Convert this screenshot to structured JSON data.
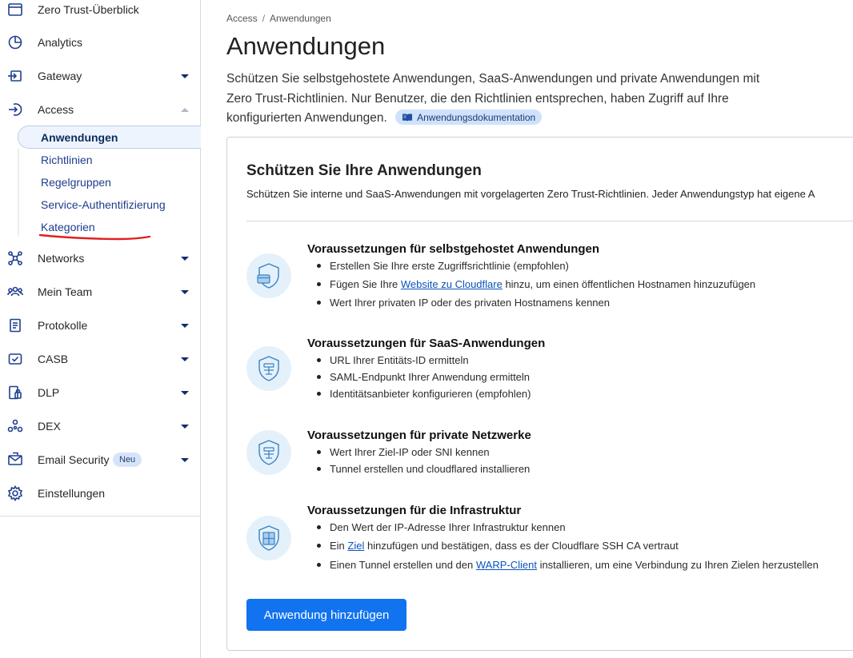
{
  "sidebar": {
    "items": [
      {
        "label": "Zero Trust-Überblick",
        "icon": "window-icon"
      },
      {
        "label": "Analytics",
        "icon": "pie-chart-icon"
      },
      {
        "label": "Gateway",
        "icon": "gateway-icon"
      },
      {
        "label": "Access",
        "icon": "login-icon"
      },
      {
        "label": "Networks",
        "icon": "network-icon"
      },
      {
        "label": "Mein Team",
        "icon": "team-icon"
      },
      {
        "label": "Protokolle",
        "icon": "document-icon"
      },
      {
        "label": "CASB",
        "icon": "casb-icon"
      },
      {
        "label": "DLP",
        "icon": "dlp-icon"
      },
      {
        "label": "DEX",
        "icon": "dex-icon"
      },
      {
        "label": "Email Security",
        "icon": "email-icon",
        "badge": "Neu"
      },
      {
        "label": "Einstellungen",
        "icon": "gear-icon"
      }
    ],
    "access_sub": [
      "Anwendungen",
      "Richtlinien",
      "Regelgruppen",
      "Service-Authentifizierung",
      "Kategorien"
    ]
  },
  "breadcrumb": {
    "root": "Access",
    "sep": "/",
    "current": "Anwendungen"
  },
  "page": {
    "title": "Anwendungen",
    "description": "Schützen Sie selbstgehostete Anwendungen, SaaS-Anwendungen und private Anwendungen mit Zero Trust-Richtlinien. Nur Benutzer, die den Richtlinien entsprechen, haben Zugriff auf Ihre konfigurierten Anwendungen.",
    "doc_link": "Anwendungsdokumentation"
  },
  "card": {
    "title": "Schützen Sie Ihre Anwendungen",
    "subtitle": "Schützen Sie interne und SaaS-Anwendungen mit vorgelagerten Zero Trust-Richtlinien. Jeder Anwendungstyp hat eigene A",
    "sections": [
      {
        "title": "Voraussetzungen für selbstgehostet Anwendungen",
        "b1": "Erstellen Sie Ihre erste Zugriffsrichtlinie (empfohlen)",
        "b2_pre": "Fügen Sie Ihre ",
        "b2_link": "Website zu Cloudflare",
        "b2_post": " hinzu, um einen öffentlichen Hostnamen hinzuzufügen",
        "b3": "Wert Ihrer privaten IP oder des privaten Hostnamens kennen"
      },
      {
        "title": "Voraussetzungen für SaaS-Anwendungen",
        "b1": "URL Ihrer Entitäts-ID ermitteln",
        "b2": "SAML-Endpunkt Ihrer Anwendung ermitteln",
        "b3": "Identitätsanbieter konfigurieren (empfohlen)"
      },
      {
        "title": "Voraussetzungen für private Netzwerke",
        "b1": "Wert Ihrer Ziel-IP oder SNI kennen",
        "b2": "Tunnel erstellen und cloudflared installieren"
      },
      {
        "title": "Voraussetzungen für die Infrastruktur",
        "b1": "Den Wert der IP-Adresse Ihrer Infrastruktur kennen",
        "b2_pre": "Ein ",
        "b2_link": "Ziel",
        "b2_post": " hinzufügen und bestätigen, dass es der Cloudflare SSH CA vertraut",
        "b3_pre": "Einen Tunnel erstellen und den ",
        "b3_link": "WARP-Client",
        "b3_post": " installieren, um eine Verbindung zu Ihren Zielen herzustellen"
      }
    ],
    "button": "Anwendung hinzufügen"
  },
  "colors": {
    "accent": "#1173f0",
    "nav_icon": "#1f3f8f",
    "annotation_red": "#e02020",
    "icon_circle": "#e4f1fb"
  }
}
